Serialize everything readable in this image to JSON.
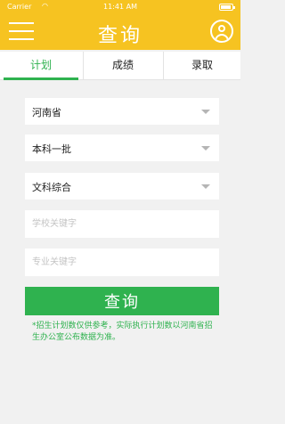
{
  "status_bar": {
    "carrier": "Carrier",
    "time": "11:41 AM",
    "battery_level": 0.9
  },
  "header": {
    "title": "查询",
    "menu_icon": "hamburger-icon",
    "user_icon": "user-icon",
    "accent_color": "#f6c321"
  },
  "tabs": [
    {
      "label": "计划",
      "active": true
    },
    {
      "label": "成绩",
      "active": false
    },
    {
      "label": "录取",
      "active": false
    }
  ],
  "form": {
    "province": {
      "value": "河南省"
    },
    "batch": {
      "value": "本科一批"
    },
    "category": {
      "value": "文科综合"
    },
    "school_keyword": {
      "value": "",
      "placeholder": "学校关键字"
    },
    "major_keyword": {
      "value": "",
      "placeholder": "专业关键字"
    },
    "submit_label": "查询",
    "submit_color": "#2fb24f"
  },
  "note": "*招生计划数仅供参考，实际执行计划数以河南省招生办公室公布数据为准。"
}
